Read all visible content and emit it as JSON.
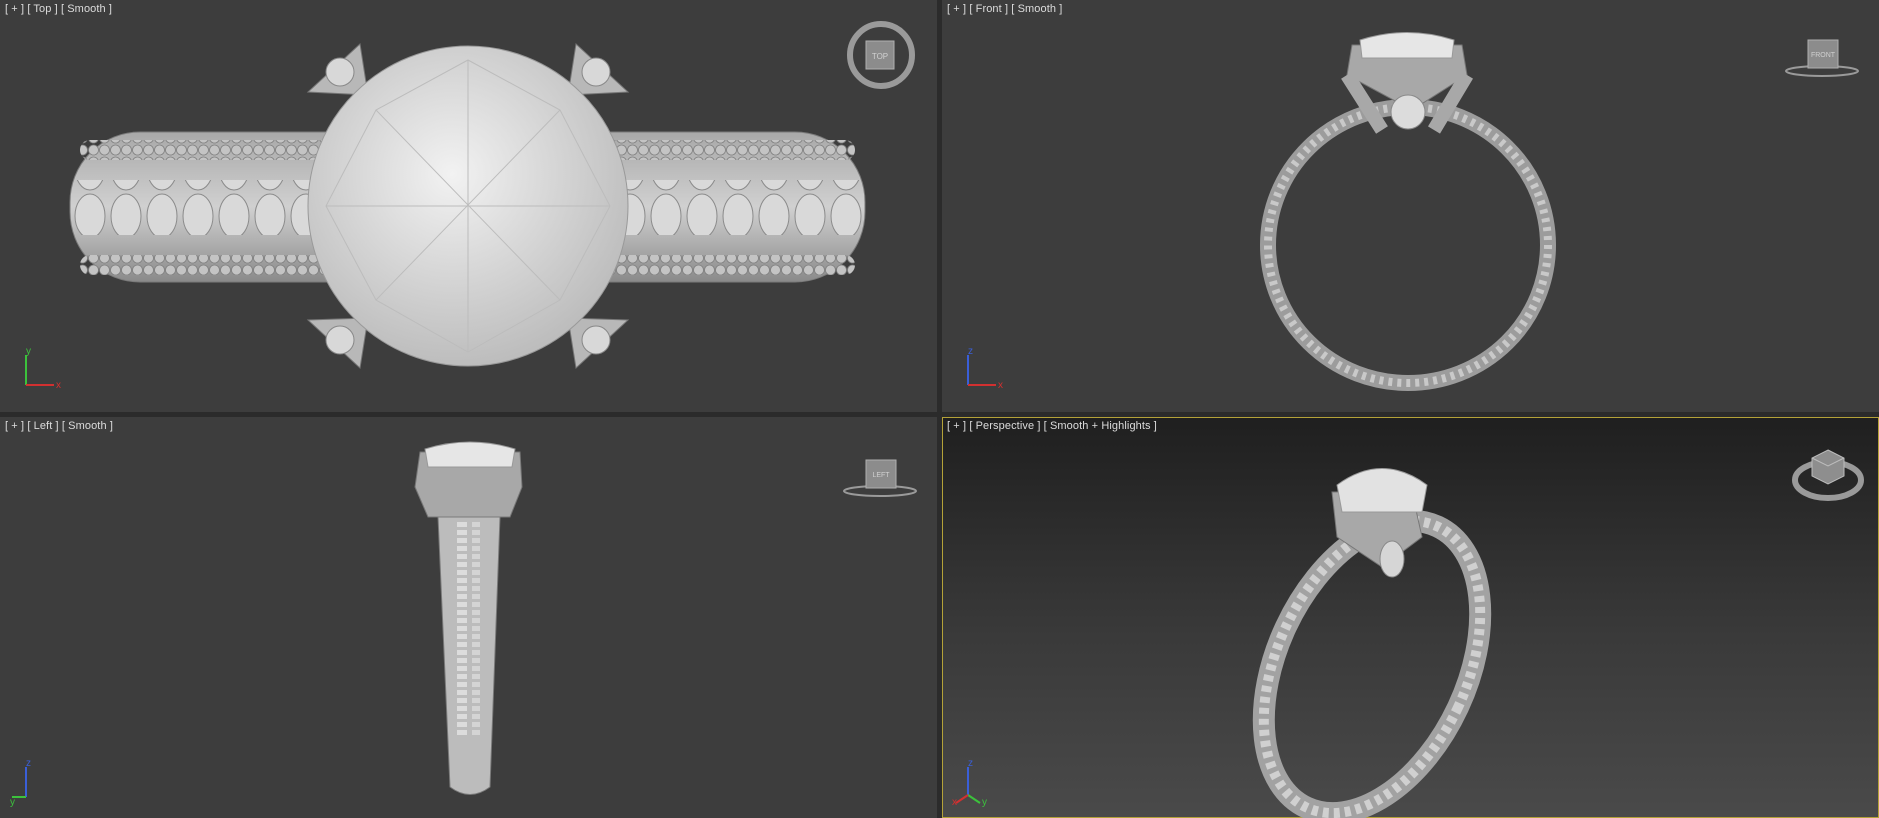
{
  "viewports": {
    "top": {
      "menu": "[ + ]",
      "view": "[ Top ]",
      "shading": "[ Smooth ]",
      "cube_label": "TOP"
    },
    "front": {
      "menu": "[ + ]",
      "view": "[ Front ]",
      "shading": "[ Smooth ]",
      "cube_label": "FRONT"
    },
    "left": {
      "menu": "[ + ]",
      "view": "[ Left ]",
      "shading": "[ Smooth ]",
      "cube_label": "LEFT"
    },
    "persp": {
      "menu": "[ + ]",
      "view": "[ Perspective ]",
      "shading": "[ Smooth + Highlights ]",
      "cube_label": ""
    }
  },
  "axes": {
    "top": [
      "y",
      "x"
    ],
    "front": [
      "z",
      "x"
    ],
    "left": [
      "z",
      "y"
    ],
    "persp": [
      "z",
      "y",
      "x"
    ]
  },
  "colors": {
    "viewport_bg": "#3d3d3d",
    "active_border": "#b4a238",
    "axis_x": "#d23030",
    "axis_y": "#3cc23c",
    "axis_z": "#3a5fd8"
  }
}
